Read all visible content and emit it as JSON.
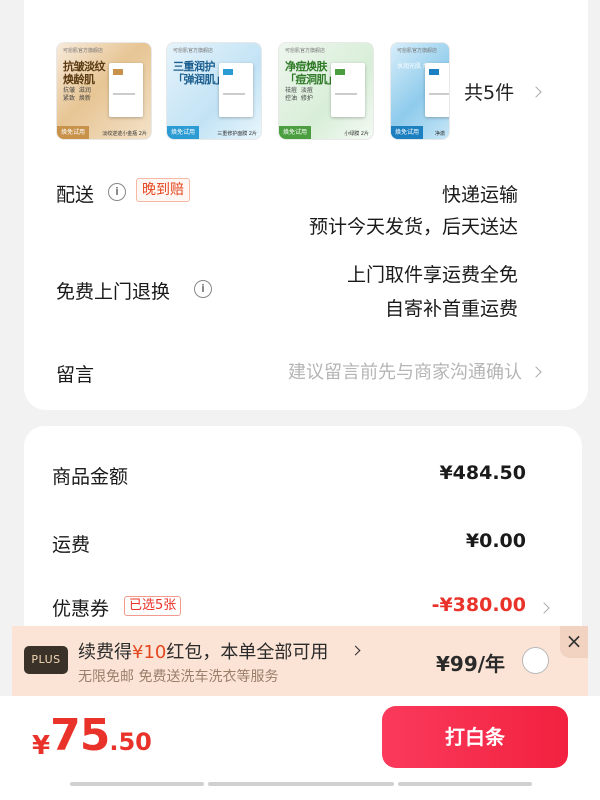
{
  "products": {
    "items": [
      {
        "brand": "可愈肌官方旗舰店",
        "title": "抗皱淡纹\n焕龄肌",
        "sub": "抗皱  滋润\n紧致  焕新",
        "tag": "焕免试用",
        "tag_note": "淡纹逆迹小金瓶 2片",
        "accent": "#c8924a"
      },
      {
        "brand": "可愈肌官方旗舰店",
        "title": "三重润护\n「弹润肌」",
        "sub": "",
        "tag": "焕免试用",
        "tag_note": "三重修护面膜 2片",
        "accent": "#2b9bd3"
      },
      {
        "brand": "可愈肌官方旗舰店",
        "title": "净痘焕肤\n「痘洞肌」",
        "sub": "祛痘  淡痘\n控油  修护",
        "tag": "焕免试用",
        "tag_note": "小绿膜 2片",
        "accent": "#4a9e3f"
      },
      {
        "brand": "可愈肌官方旗舰店",
        "title": "",
        "sub": "水润光肌  焕颜",
        "tag": "焕免试用",
        "tag_note": "净澈",
        "accent": "#1c7fc0"
      }
    ],
    "count_label": "共5件"
  },
  "delivery": {
    "label": "配送",
    "badge": "晚到赔",
    "method": "快递运输",
    "eta": "预计今天发货，后天送达"
  },
  "returns": {
    "label": "免费上门退换",
    "line1": "上门取件享运费全免",
    "line2": "自寄补首重运费"
  },
  "message": {
    "label": "留言",
    "placeholder": "建议留言前先与商家沟通确认"
  },
  "summary": {
    "goods_label": "商品金额",
    "goods_value": "¥484.50",
    "shipping_label": "运费",
    "shipping_value": "¥0.00",
    "coupon_label": "优惠券",
    "coupon_badge": "已选5张",
    "coupon_value": "-¥380.00"
  },
  "plus": {
    "logo": "PLUS",
    "main_prefix": "续费得",
    "main_highlight": "¥10",
    "main_suffix": "红包，本单全部可用",
    "sub": "无限免邮 免费送洗车洗衣等服务",
    "price": "¥99/年",
    "close": "×"
  },
  "checkout": {
    "currency": "¥",
    "total_int": "75",
    "total_dec": ".50",
    "pay_label": "打白条"
  },
  "colors": {
    "accent_red": "#e9332a",
    "pay_button": "#f2213f",
    "plus_bg": "#fbe4d6"
  }
}
